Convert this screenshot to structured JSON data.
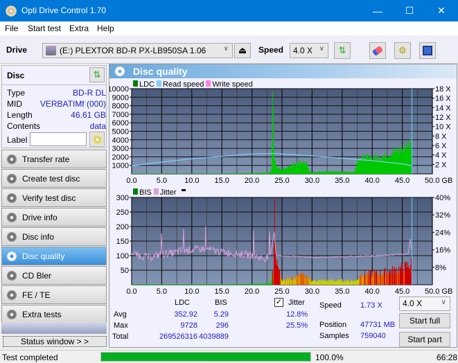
{
  "window": {
    "title": "Opti Drive Control 1.70",
    "minimize": "—",
    "maximize": "☐",
    "close": "✕"
  },
  "menu": [
    "File",
    "Start test",
    "Extra",
    "Help"
  ],
  "toolbar": {
    "drive_label": "Drive",
    "drive_value": "(E:)  PLEXTOR BD-R  PX-LB950SA 1.06",
    "speed_label": "Speed",
    "speed_value": "4.0 X"
  },
  "disc": {
    "header": "Disc",
    "rows": [
      {
        "label": "Type",
        "value": "BD-R DL"
      },
      {
        "label": "MID",
        "value": "VERBATIMf (000)"
      },
      {
        "label": "Length",
        "value": "46.61 GB"
      },
      {
        "label": "Contents",
        "value": "data"
      }
    ],
    "label_label": "Label",
    "label_value": ""
  },
  "nav": [
    {
      "label": "Transfer rate",
      "active": false
    },
    {
      "label": "Create test disc",
      "active": false
    },
    {
      "label": "Verify test disc",
      "active": false
    },
    {
      "label": "Drive info",
      "active": false
    },
    {
      "label": "Disc info",
      "active": false
    },
    {
      "label": "Disc quality",
      "active": true
    },
    {
      "label": "CD Bler",
      "active": false
    },
    {
      "label": "FE / TE",
      "active": false
    },
    {
      "label": "Extra tests",
      "active": false
    }
  ],
  "status_window_label": "Status window > >",
  "panel_title": "Disc quality",
  "colors": {
    "ldc": "#00c800",
    "read_speed": "#7fd0f8",
    "write_speed": "#ff80e0",
    "bis": "#008000",
    "jitter": "#d8a0d8",
    "plot_bg_top": "#4a5a7a",
    "plot_bg_bottom": "#8090b0",
    "progress": "#00b020"
  },
  "chart_data": [
    {
      "type": "area",
      "title": "LDC / Read speed",
      "legend": [
        "LDC",
        "Read speed",
        "Write speed"
      ],
      "legend_position": "top-left",
      "xlabel": "GB",
      "xlim": [
        0,
        50
      ],
      "x_ticks": [
        "0.0",
        "5.0",
        "10.0",
        "15.0",
        "20.0",
        "25.0",
        "30.0",
        "35.0",
        "40.0",
        "45.0",
        "50.0 GB"
      ],
      "ylim_left": [
        0,
        10000
      ],
      "y_ticks_left": [
        "10000",
        "9000",
        "8000",
        "7000",
        "6000",
        "5000",
        "4000",
        "3000",
        "2000",
        "1000"
      ],
      "ylim_right": [
        0,
        18
      ],
      "y_ticks_right": [
        "18 X",
        "16 X",
        "14 X",
        "12 X",
        "10 X",
        "8 X",
        "6 X",
        "4 X",
        "2 X"
      ],
      "grid": true,
      "series": [
        {
          "name": "LDC",
          "x": [
            0,
            5,
            10,
            15,
            20,
            22.8,
            23.2,
            23.4,
            23.6,
            24,
            25,
            26,
            27,
            28,
            29,
            29.5,
            30,
            33,
            35,
            37,
            37.5,
            38,
            40,
            42,
            44,
            45,
            46,
            46.6
          ],
          "y": [
            50,
            50,
            50,
            50,
            80,
            150,
            600,
            9728,
            3000,
            800,
            500,
            900,
            1200,
            1500,
            1300,
            300,
            200,
            300,
            250,
            250,
            1800,
            1900,
            1900,
            2200,
            2700,
            3000,
            3500,
            3900
          ]
        },
        {
          "name": "Read speed",
          "x": [
            0,
            5,
            10,
            15,
            20,
            23.5,
            25,
            30,
            35,
            40,
            45,
            46.6
          ],
          "y": [
            1.7,
            2.5,
            3.2,
            3.7,
            4.2,
            4.3,
            4.2,
            3.8,
            3.3,
            2.8,
            2.1,
            1.73
          ]
        },
        {
          "name": "Write speed",
          "x": [],
          "y": []
        }
      ],
      "end_marker_gb": 46.6
    },
    {
      "type": "area",
      "title": "BIS / Jitter",
      "legend": [
        "BIS",
        "Jitter"
      ],
      "legend_position": "top-left",
      "xlabel": "GB",
      "xlim": [
        0,
        50
      ],
      "x_ticks": [
        "0.0",
        "5.0",
        "10.0",
        "15.0",
        "20.0",
        "25.0",
        "30.0",
        "35.0",
        "40.0",
        "45.0",
        "50.0 GB"
      ],
      "ylim_left": [
        0,
        300
      ],
      "y_ticks_left": [
        "300",
        "250",
        "200",
        "150",
        "100",
        "50"
      ],
      "ylim_right": [
        0,
        40
      ],
      "y_ticks_right": [
        "40%",
        "32%",
        "24%",
        "16%",
        "8%"
      ],
      "grid": true,
      "series": [
        {
          "name": "BIS",
          "x": [
            0,
            5,
            10,
            15,
            20,
            23,
            23.5,
            23.7,
            24,
            25,
            27,
            28,
            30,
            35,
            37.5,
            38,
            40,
            42,
            44,
            45,
            46,
            46.6
          ],
          "y": [
            2,
            2,
            2,
            2,
            3,
            5,
            60,
            296,
            80,
            20,
            25,
            40,
            15,
            15,
            15,
            40,
            40,
            45,
            55,
            60,
            70,
            80
          ]
        },
        {
          "name": "Jitter",
          "x": [
            0,
            1,
            2,
            3,
            5,
            7,
            8,
            10,
            12,
            15,
            18,
            20,
            22,
            23,
            23.4,
            23.7,
            24,
            26,
            28,
            30,
            35,
            40,
            44,
            46,
            46.3,
            46.6
          ],
          "y": [
            15,
            13.5,
            13,
            12.5,
            14,
            14.5,
            15.5,
            16,
            16.5,
            15,
            14,
            13.5,
            12,
            13,
            18,
            25.5,
            13.5,
            13,
            13,
            12.5,
            12.8,
            13.2,
            13.8,
            14,
            21,
            15
          ]
        }
      ],
      "end_marker_gb": 46.6
    }
  ],
  "stats": {
    "col_ldc": "LDC",
    "col_bis": "BIS",
    "rows": [
      {
        "label": "Avg",
        "ldc": "352.92",
        "bis": "5.29",
        "jitter": "12.8%"
      },
      {
        "label": "Max",
        "ldc": "9728",
        "bis": "296",
        "jitter": "25.5%"
      },
      {
        "label": "Total",
        "ldc": "269526316",
        "bis": "4039889"
      }
    ],
    "jitter_label": "Jitter",
    "jitter_checked": true,
    "speed_label": "Speed",
    "speed_value": "1.73 X",
    "position_label": "Position",
    "position_value": "47731 MB",
    "samples_label": "Samples",
    "samples_value": "759040",
    "speed_select": "4.0 X",
    "start_full": "Start full",
    "start_part": "Start part"
  },
  "statusbar": {
    "text": "Test completed",
    "progress_percent": 100.0,
    "progress_label": "100.0%",
    "time": "66:28"
  }
}
